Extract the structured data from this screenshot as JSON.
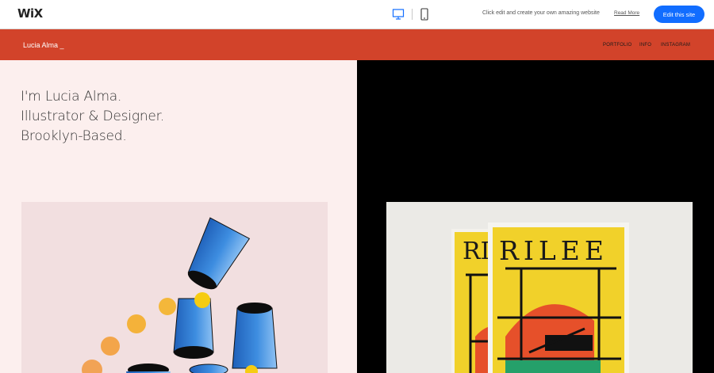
{
  "wix_bar": {
    "logo": "WiX",
    "promo_text": "Click edit and create your own amazing website",
    "read_more": "Read More",
    "edit_button": "Edit this site",
    "icons": [
      "desktop-icon",
      "mobile-icon"
    ],
    "accent_color": "#116dff"
  },
  "site_header": {
    "site_name": "Lucia Alma _",
    "nav": [
      "PORTFOLIO",
      "INFO",
      "INSTAGRAM"
    ],
    "background_color": "#d2432a"
  },
  "hero": {
    "lines": [
      "I'm Lucia Alma.",
      "Illustrator & Designer.",
      "Brooklyn-Based."
    ]
  },
  "poster": {
    "letters_back": "RI",
    "letters_front": "RILEE"
  },
  "colors": {
    "left_bg": "#fcefee",
    "right_bg": "#000000"
  }
}
